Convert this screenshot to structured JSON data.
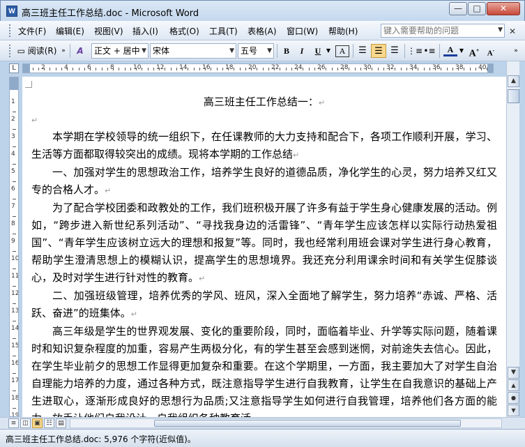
{
  "window": {
    "title": "高三班主任工作总结.doc - Microsoft Word",
    "app_icon": "W",
    "minimize_glyph": "—",
    "maximize_glyph": "□",
    "close_glyph": "✕"
  },
  "menubar": {
    "items": [
      "文件(F)",
      "编辑(E)",
      "视图(V)",
      "插入(I)",
      "格式(O)",
      "工具(T)",
      "表格(A)",
      "窗口(W)",
      "帮助(H)"
    ],
    "help_placeholder": "键入需要帮助的问题",
    "doc_close_glyph": "✕"
  },
  "toolbar": {
    "reading_label": "阅读(R)",
    "style_value": "正文 + 居中",
    "font_value": "宋体",
    "size_value": "五号",
    "bold": "B",
    "italic": "I",
    "underline": "U",
    "char_border": "A",
    "font_color": "A",
    "grow_font": "A",
    "shrink_font": "A"
  },
  "ruler": {
    "h_numbers": [
      "2",
      "4",
      "6",
      "8",
      "10",
      "12",
      "14",
      "16",
      "18",
      "20",
      "22",
      "24",
      "26",
      "28",
      "30",
      "32",
      "34",
      "36",
      "38",
      "40"
    ],
    "v_numbers": [
      "1",
      "2",
      "3",
      "4",
      "5",
      "6",
      "7",
      "8",
      "9",
      "10",
      "11",
      "12",
      "13",
      "14",
      "15",
      "16",
      "17",
      "18",
      "19"
    ],
    "corner_glyph": "L"
  },
  "document": {
    "title": "高三班主任工作总结一：",
    "paragraphs": [
      "本学期在学校领导的统一组织下，在任课教师的大力支持和配合下，各项工作顺利开展，学习、生活等方面都取得较突出的成绩。现将本学期的工作总结",
      "一、加强对学生的思想政治工作，培养学生良好的道德品质，净化学生的心灵，努力培养又红又专的合格人才。",
      "为了配合学校团委和政教处的工作，我们班积极开展了许多有益于学生身心健康发展的活动。例如，“跨步进入新世纪系列活动”、“寻找我身边的活雷锋”、“青年学生应该怎样以实际行动热爱祖国”、“青年学生应该树立远大的理想和报复”等。同时，我也经常利用班会课对学生进行身心教育，帮助学生澄清思想上的模糊认识，提高学生的思想境界。我还充分利用课余时间和有关学生促膝谈心，及时对学生进行针对性的教育。",
      "二、加强班级管理，培养优秀的学风、班风，深入全面地了解学生，努力培养“赤诚、严格、活跃、奋进”的班集体。",
      "高三年级是学生的世界观发展、变化的重要阶段，同时，面临着毕业、升学等实际问题，随着课时和知识复杂程度的加重，容易产生两极分化，有的学生甚至会感到迷惘，对前途失去信心。因此，在学生毕业前夕的思想工作显得更加复杂和重要。在这个学期里，一方面，我主要加大了对学生自治自理能力培养的力度，通过各种方式，既注意指导学生进行自我教育，让学生在自我意识的基础上产生进取心，逐渐形成良好的思想行为品质;又注意指导学生如何进行自我管理，培养他们各方面的能力，放手让他们自我设计、自我组织各种教育活"
    ],
    "para_mark": "↵"
  },
  "statusbar": {
    "text": "高三班主任工作总结.doc: 5,976 个字符(近似值)。"
  }
}
